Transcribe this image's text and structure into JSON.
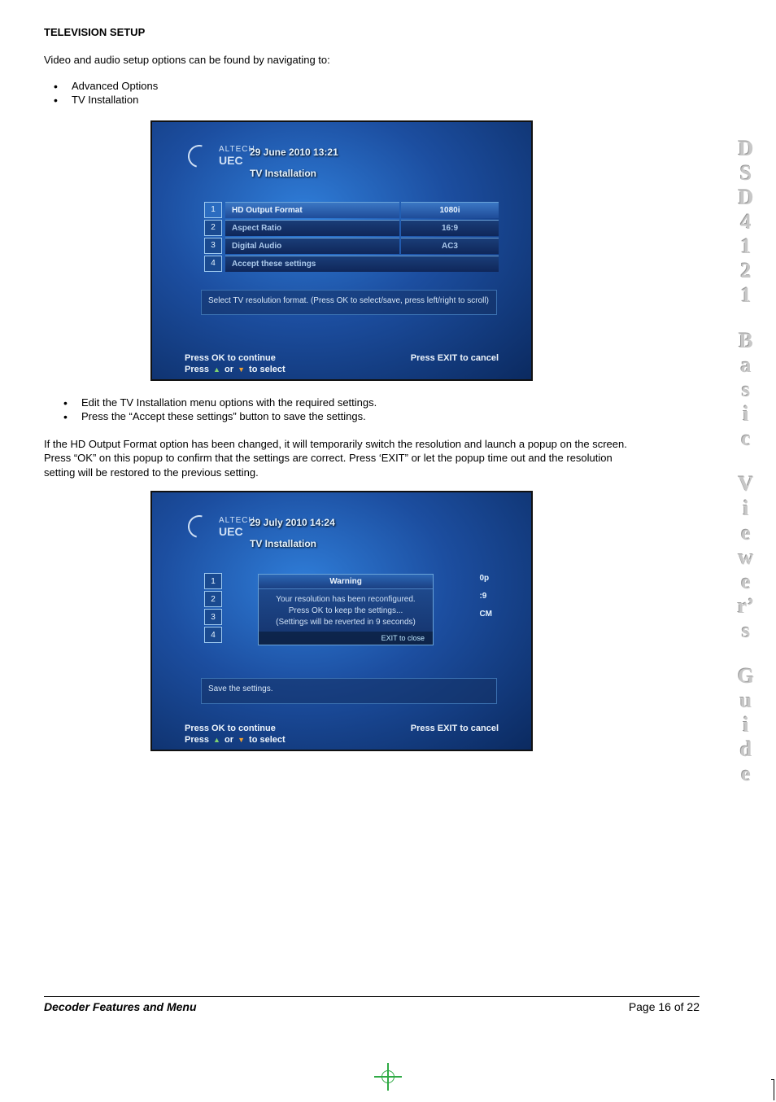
{
  "heading": "TELEVISION SETUP",
  "intro": "Video and audio setup options can be found by navigating to:",
  "nav_bullets": [
    "Advanced Options",
    "TV Installation"
  ],
  "shot1": {
    "brand_top": "ALTECH",
    "brand_bot": "UEC",
    "date": "29 June 2010 13:21",
    "title": "TV Installation",
    "rows": [
      {
        "num": "1",
        "label": "HD Output Format",
        "value": "1080i",
        "selected": true
      },
      {
        "num": "2",
        "label": "Aspect Ratio",
        "value": "16:9",
        "selected": false
      },
      {
        "num": "3",
        "label": "Digital Audio",
        "value": "AC3",
        "selected": false
      },
      {
        "num": "4",
        "label": "Accept these settings",
        "value": "",
        "selected": false
      }
    ],
    "help": "Select TV resolution format. (Press OK to select/save, press left/right to scroll)",
    "footer_ok": "Press OK to continue",
    "footer_exit": "Press EXIT to cancel",
    "footer_select_pre": "Press ",
    "footer_select_post": " to select"
  },
  "action_bullets": [
    "Edit the TV Installation menu options with the required settings.",
    "Press the “Accept these settings” button to save the settings."
  ],
  "mid_para": "If the HD Output Format option has been changed, it will temporarily switch the resolution and launch a popup on the screen.  Press “OK” on this popup to confirm that the settings are correct.  Press ‘EXIT” or let the popup time out and the resolution setting will be restored to the previous setting.",
  "shot2": {
    "brand_top": "ALTECH",
    "brand_bot": "UEC",
    "date": "29 July 2010 14:24",
    "title": "TV Installation",
    "bg_nums": [
      "1",
      "2",
      "3",
      "4"
    ],
    "bg_vals": [
      "0p",
      ":9",
      "CM"
    ],
    "popup": {
      "title": "Warning",
      "line1": "Your resolution has been reconfigured.",
      "line2": "Press OK to keep the settings...",
      "line3": "(Settings will be reverted in 9 seconds)",
      "close": "EXIT   to close"
    },
    "help": "Save the settings.",
    "footer_ok": "Press OK to continue",
    "footer_exit": "Press EXIT to cancel",
    "footer_select_pre": "Press ",
    "footer_select_post": " to select"
  },
  "sideband": [
    "D",
    "S",
    "D",
    "4",
    "1",
    "2",
    "1",
    "",
    "B",
    "a",
    "s",
    "i",
    "c",
    "",
    "V",
    "i",
    "e",
    "w",
    "e",
    "r’",
    "s",
    "",
    "G",
    "u",
    "i",
    "d",
    "e"
  ],
  "footer": {
    "left": "Decoder Features and Menu",
    "right": "Page 16 of 22"
  }
}
